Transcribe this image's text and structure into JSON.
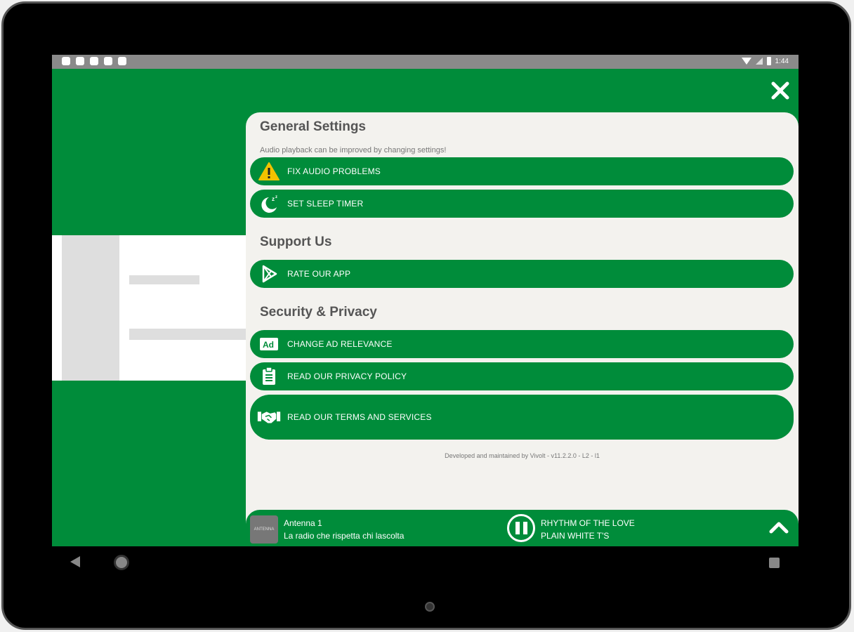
{
  "status": {
    "time": "1:44"
  },
  "general": {
    "title": "General Settings",
    "subtitle": "Audio playback can be improved by changing settings!",
    "items": [
      {
        "label": "FIX AUDIO PROBLEMS",
        "icon": "warning-icon"
      },
      {
        "label": "SET SLEEP TIMER",
        "icon": "moon-sleep-icon"
      }
    ]
  },
  "support": {
    "title": "Support Us",
    "items": [
      {
        "label": "RATE OUR APP",
        "icon": "play-store-icon"
      }
    ]
  },
  "security": {
    "title": "Security & Privacy",
    "items": [
      {
        "label": "CHANGE AD RELEVANCE",
        "icon": "ad-icon"
      },
      {
        "label": "READ OUR PRIVACY POLICY",
        "icon": "clipboard-icon"
      },
      {
        "label": "READ OUR TERMS AND SERVICES",
        "icon": "handshake-icon"
      }
    ]
  },
  "footer": {
    "note": "Developed and maintained by Vivolt - v11.2.2.0 - L2 - l1"
  },
  "player": {
    "station_name": "Antenna 1",
    "station_tagline": "La radio che rispetta chi lascolta",
    "logo_text": "ANTENNA",
    "track_title": "RHYTHM OF THE LOVE",
    "track_artist": "PLAIN WHITE T'S"
  },
  "colors": {
    "accent": "#008c3a",
    "sheet": "#f3f2ee",
    "warning": "#f2c200"
  }
}
